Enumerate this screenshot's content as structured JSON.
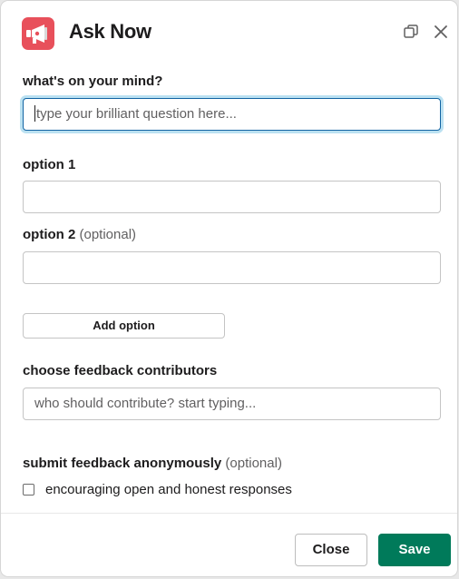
{
  "header": {
    "title": "Ask Now",
    "app_icon": "megaphone-icon",
    "expand_icon": "expand-window-icon",
    "close_icon": "close-icon"
  },
  "form": {
    "question": {
      "label": "what's on your mind?",
      "placeholder": "type your brilliant question here...",
      "value": ""
    },
    "option1": {
      "label": "option 1",
      "value": ""
    },
    "option2": {
      "label": "option 2",
      "optional": "(optional)",
      "value": ""
    },
    "add_option_label": "Add option",
    "contributors": {
      "label": "choose feedback contributors",
      "placeholder": "who should contribute? start typing..."
    },
    "anonymous": {
      "label": "submit feedback anonymously",
      "optional": "(optional)",
      "checkbox_label": "encouraging open and honest responses",
      "checked": false
    }
  },
  "footer": {
    "close_label": "Close",
    "save_label": "Save"
  },
  "colors": {
    "app_icon_bg": "#e8505b",
    "focus_ring": "#1264a3",
    "save_bg": "#007a5a"
  }
}
